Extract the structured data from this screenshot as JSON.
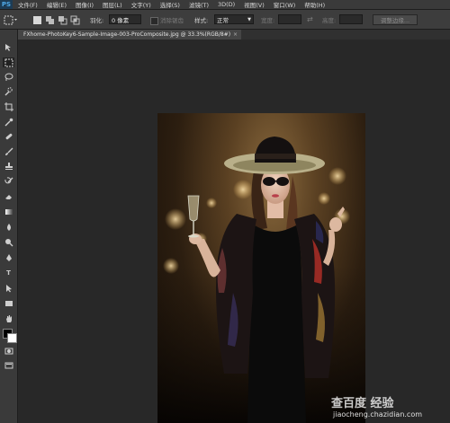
{
  "menubar": {
    "logo": "PS",
    "items": [
      "文件(F)",
      "编辑(E)",
      "图像(I)",
      "图层(L)",
      "文字(Y)",
      "选择(S)",
      "滤镜(T)",
      "3D(D)",
      "视图(V)",
      "窗口(W)",
      "帮助(H)"
    ]
  },
  "options": {
    "feather_label": "羽化:",
    "feather_value": "0 像素",
    "antialias_label": "消除锯齿",
    "style_label": "样式:",
    "style_value": "正常",
    "width_label": "宽度:",
    "height_label": "高度:",
    "refine_edge_button": "调整边缘..."
  },
  "tab": {
    "title": "FXhome-PhotoKey6-Sample-Image-003-ProComposite.jpg @ 33.3%(RGB/8#)",
    "close": "×"
  },
  "toolbox": {
    "tools": [
      "move-icon",
      "marquee-icon",
      "lasso-icon",
      "quick-select-icon",
      "crop-icon",
      "eyedropper-icon",
      "healing-icon",
      "brush-icon",
      "stamp-icon",
      "history-brush-icon",
      "eraser-icon",
      "gradient-icon",
      "blur-icon",
      "dodge-icon",
      "pen-icon",
      "type-icon",
      "path-select-icon",
      "shape-icon",
      "hand-icon",
      "zoom-icon"
    ]
  },
  "watermark": {
    "logo": "查百度 经验",
    "url": "jiaocheng.chazidian.com"
  },
  "colors": {
    "fg": "#000000",
    "bg": "#ffffff",
    "accent": "#4fa8e6"
  }
}
